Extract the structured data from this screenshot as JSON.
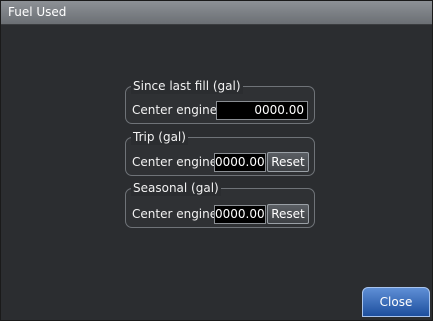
{
  "dialog": {
    "title": "Fuel Used"
  },
  "groups": {
    "since_last_fill": {
      "legend": "Since last fill (gal)",
      "engine_label": "Center engine",
      "value": "0000.00"
    },
    "trip": {
      "legend": "Trip (gal)",
      "engine_label": "Center engine",
      "value": "0000.00",
      "reset_label": "Reset"
    },
    "seasonal": {
      "legend": "Seasonal (gal)",
      "engine_label": "Center engine",
      "value": "0000.00",
      "reset_label": "Reset"
    }
  },
  "footer": {
    "close_label": "Close"
  },
  "colors": {
    "background": "#2b2d30",
    "titlebar": "#7c8085",
    "close_button": "#2f63b4"
  }
}
